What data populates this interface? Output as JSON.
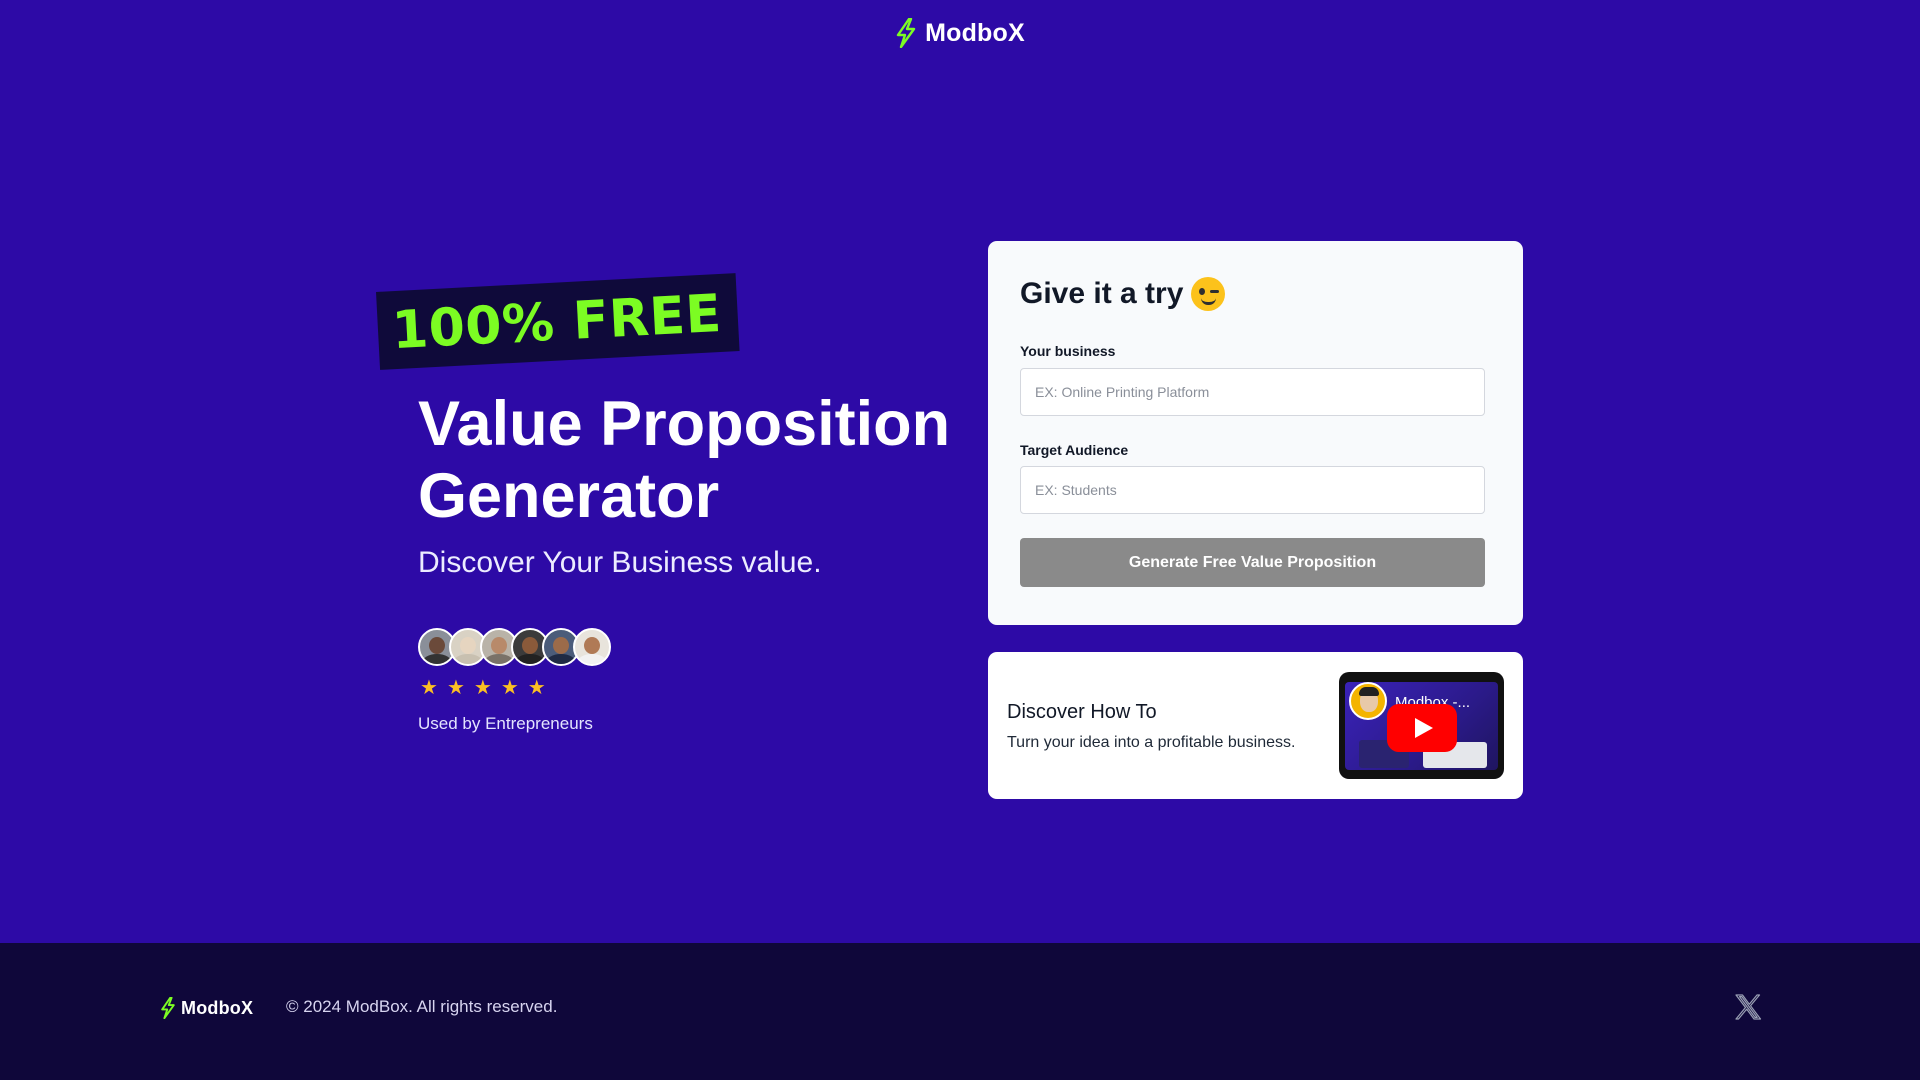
{
  "header": {
    "brand": "ModboX"
  },
  "hero": {
    "badge": "100% FREE",
    "title": "Value Proposition Generator",
    "subtitle": "Discover Your Business value.",
    "rating_stars": 5,
    "social_proof": "Used by Entrepreneurs"
  },
  "form": {
    "title": "Give it a try",
    "business_label": "Your business",
    "business_placeholder": "EX: Online Printing Platform",
    "business_value": "",
    "audience_label": "Target Audience",
    "audience_placeholder": "EX: Students",
    "audience_value": "",
    "submit_label": "Generate Free Value Proposition"
  },
  "discover": {
    "title": "Discover How To",
    "description": "Turn your idea into a profitable business.",
    "video_title": "Modbox -..."
  },
  "footer": {
    "brand": "ModboX",
    "copyright": "© 2024 ModBox. All rights reserved."
  },
  "colors": {
    "background": "#2d0aa6",
    "accent_green": "#7cfc23",
    "footer_bg": "#0f073a",
    "button_disabled": "#8a8a8a",
    "star": "#fbbf24"
  }
}
